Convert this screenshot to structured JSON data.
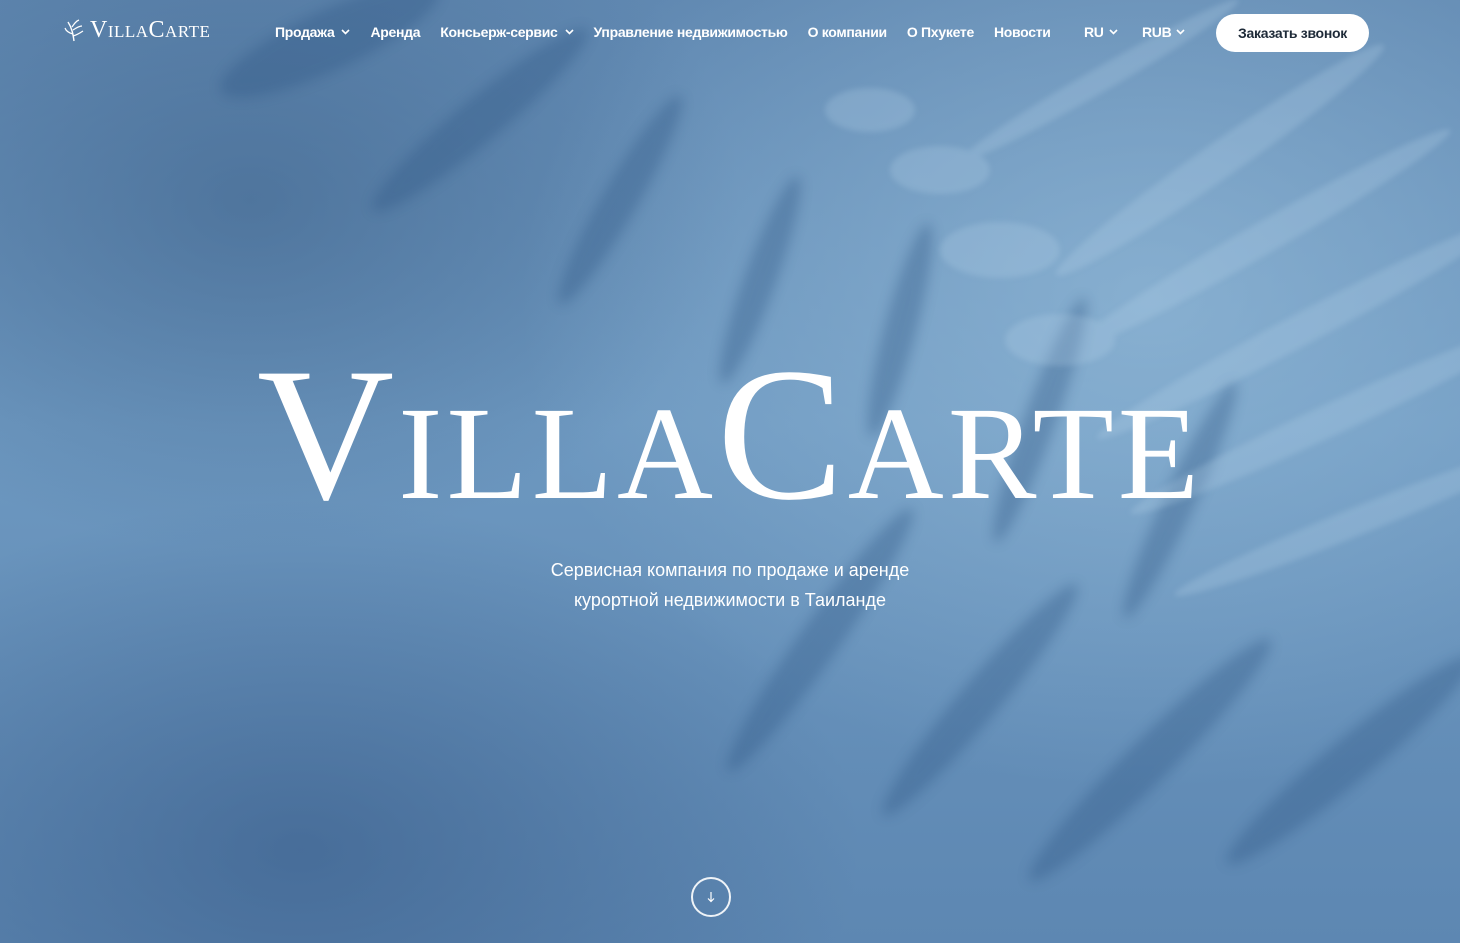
{
  "header": {
    "logo_text": "VillaCarte",
    "nav": [
      {
        "label": "Продажа",
        "has_dropdown": true
      },
      {
        "label": "Аренда",
        "has_dropdown": false
      },
      {
        "label": "Консьерж-сервис",
        "has_dropdown": true
      },
      {
        "label": "Управление недвижимостью",
        "has_dropdown": false
      },
      {
        "label": "О компании",
        "has_dropdown": false
      },
      {
        "label": "О Пхукете",
        "has_dropdown": false
      },
      {
        "label": "Новости",
        "has_dropdown": false
      }
    ],
    "language": "RU",
    "currency": "RUB",
    "cta_label": "Заказать звонок"
  },
  "hero": {
    "title": "VillaCarte",
    "subtitle_line1": "Сервисная компания по продаже и аренде",
    "subtitle_line2": "курортной недвижимости в Таиланде",
    "scroll_icon": "arrow-down-icon"
  },
  "colors": {
    "background": "#6a93bb",
    "cta_background": "#ffffff",
    "cta_text": "#1e2a38"
  }
}
